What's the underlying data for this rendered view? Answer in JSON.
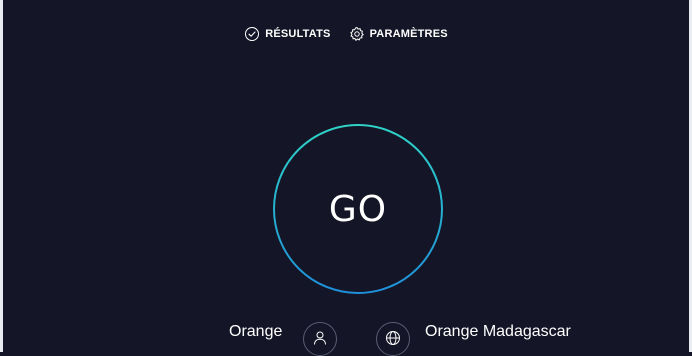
{
  "nav": {
    "results_label": "RÉSULTATS",
    "settings_label": "PARAMÈTRES"
  },
  "go_button": {
    "label": "GO"
  },
  "connection": {
    "isp_name": "Orange",
    "server_name": "Orange Madagascar"
  },
  "icons": {
    "results": "check-circle-icon",
    "settings": "gear-icon",
    "isp": "user-icon",
    "server": "globe-icon"
  },
  "colors": {
    "background": "#141526",
    "ring_start": "#2fd3c7",
    "ring_end": "#1f8fd9"
  }
}
